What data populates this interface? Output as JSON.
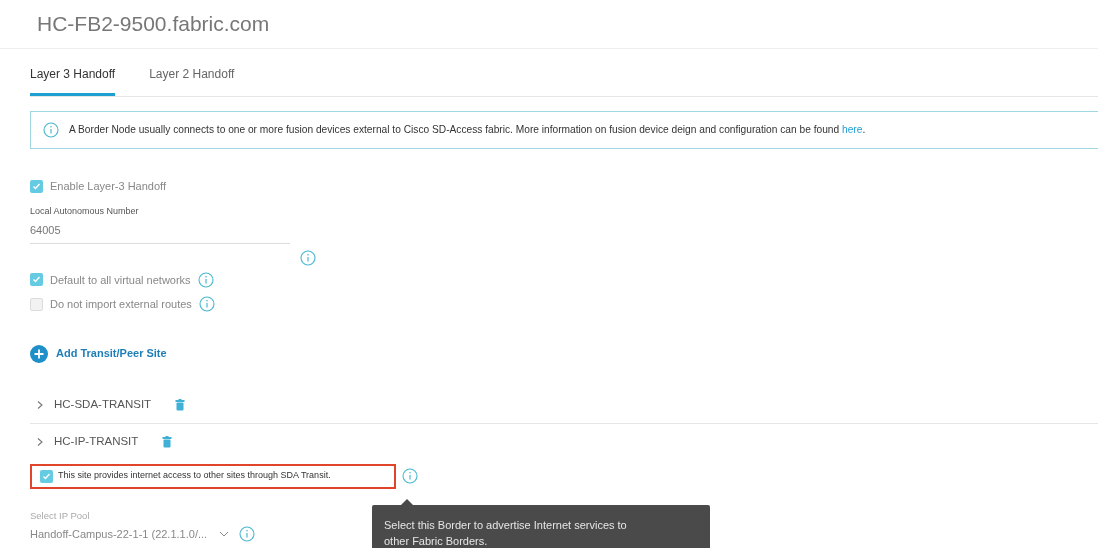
{
  "header": {
    "title": "HC-FB2-9500.fabric.com"
  },
  "tabs": [
    {
      "label": "Layer 3 Handoff",
      "selected": true
    },
    {
      "label": "Layer 2 Handoff",
      "selected": false
    }
  ],
  "banner": {
    "text": "A Border Node usually connects to one or more fusion devices external to Cisco SD-Access fabric. More information on fusion device deign and configuration can be found",
    "link": "here",
    "end": "."
  },
  "enable_handoff": {
    "label": "Enable Layer-3 Handoff",
    "checked": true
  },
  "autonomous_number": {
    "label": "Local Autonomous Number",
    "value": "64005"
  },
  "options": [
    {
      "label": "Default to all virtual networks",
      "checked": true
    },
    {
      "label": "Do not import external routes",
      "checked": false
    }
  ],
  "add_transit": {
    "label": "Add Transit/Peer Site"
  },
  "transits": [
    {
      "name": "HC-SDA-TRANSIT",
      "expanded": false
    },
    {
      "name": "HC-IP-TRANSIT",
      "expanded": false
    }
  ],
  "internet_access": {
    "label": "This site provides internet access to other sites through SDA Transit.",
    "checked": true
  },
  "tooltip": {
    "text": "Select this Border to advertise Internet services to other Fabric Borders."
  },
  "ip_pool": {
    "label": "Select IP Pool",
    "value": "Handoff-Campus-22-1-1 (22.1.1.0/..."
  }
}
